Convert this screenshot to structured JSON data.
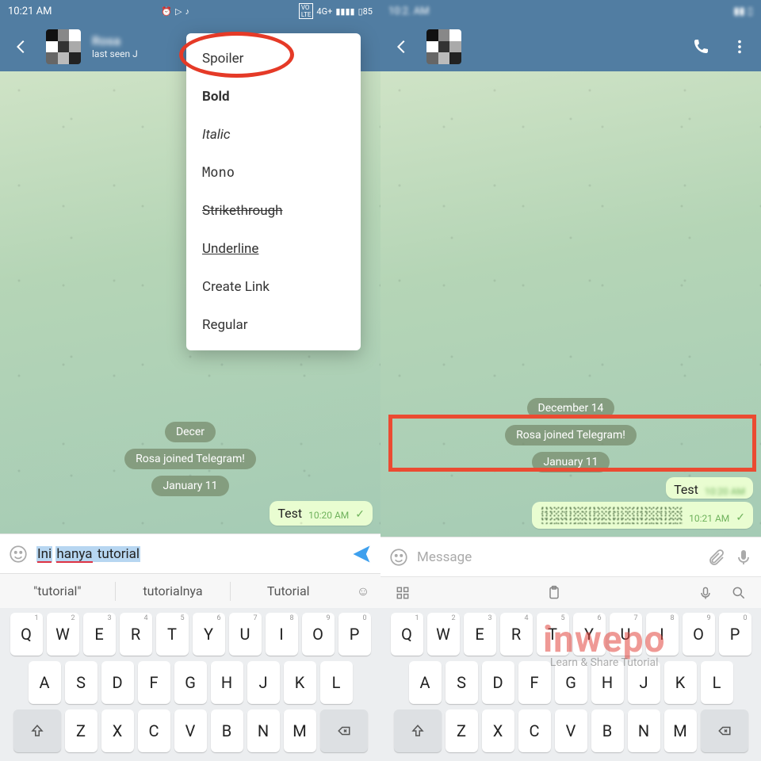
{
  "left": {
    "statusbar": {
      "time": "10:21 AM",
      "battery": "85"
    },
    "header": {
      "subtitle": "last seen J"
    },
    "menu": [
      "Spoiler",
      "Bold",
      "Italic",
      "Mono",
      "Strikethrough",
      "Underline",
      "Create Link",
      "Regular"
    ],
    "system": {
      "date1": "Decer",
      "join": "Rosa joined Telegram!",
      "date2": "January 11"
    },
    "msg": {
      "text": "Test",
      "time": "10:20 AM"
    },
    "input": {
      "w1": "Ini",
      "w2": "hanya",
      "w3": "tutorial"
    },
    "suggest": [
      "\"tutorial\"",
      "tutorialnya",
      "Tutorial"
    ]
  },
  "right": {
    "system": {
      "date1": "December 14",
      "join": "Rosa joined Telegram!",
      "date2": "January 11"
    },
    "msg1": {
      "text": "Test"
    },
    "msg2": {
      "time": "10:21 AM"
    },
    "input": {
      "placeholder": "Message"
    }
  },
  "keyboard": {
    "row1": [
      [
        "Q",
        "1"
      ],
      [
        "W",
        "2"
      ],
      [
        "E",
        "3"
      ],
      [
        "R",
        "4"
      ],
      [
        "T",
        "5"
      ],
      [
        "Y",
        "6"
      ],
      [
        "U",
        "7"
      ],
      [
        "I",
        "8"
      ],
      [
        "O",
        "9"
      ],
      [
        "P",
        "0"
      ]
    ],
    "row2": [
      "A",
      "S",
      "D",
      "F",
      "G",
      "H",
      "J",
      "K",
      "L"
    ],
    "row3": [
      "Z",
      "X",
      "C",
      "V",
      "B",
      "N",
      "M"
    ]
  },
  "watermark": {
    "brand": "inwepo",
    "tag": "Learn & Share Tutorial"
  }
}
